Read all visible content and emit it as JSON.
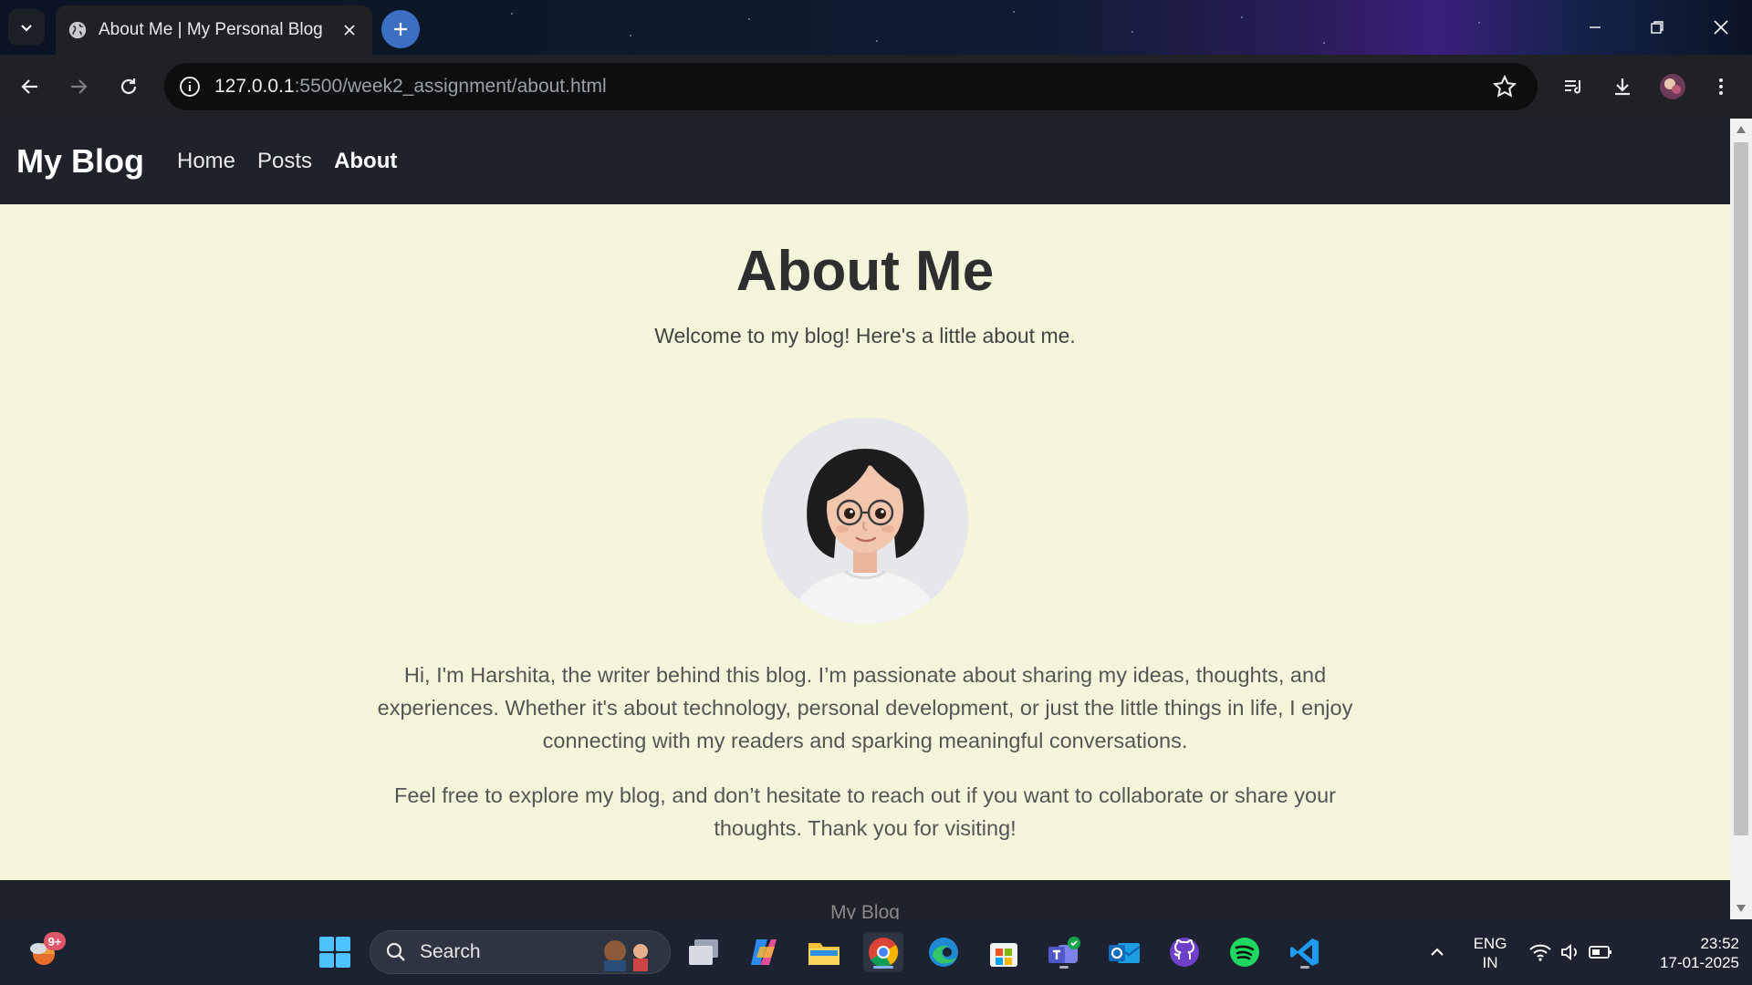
{
  "browser": {
    "tab_title": "About Me | My Personal Blog",
    "url_host": "127.0.0.1",
    "url_path": ":5500/week2_assignment/about.html"
  },
  "site": {
    "brand": "My Blog",
    "nav": [
      {
        "label": "Home",
        "active": false
      },
      {
        "label": "Posts",
        "active": false
      },
      {
        "label": "About",
        "active": true
      }
    ],
    "heading": "About Me",
    "subtitle": "Welcome to my blog! Here's a little about me.",
    "bio_1": "Hi, I'm Harshita, the writer behind this blog. I’m passionate about sharing my ideas, thoughts, and experiences. Whether it's about technology, personal development, or just the little things in life, I enjoy connecting with my readers and sparking meaningful conversations.",
    "bio_2": "Feel free to explore my blog, and don’t hesitate to reach out if you want to collaborate or share your thoughts. Thank you for visiting!",
    "footer": "My Blog"
  },
  "taskbar": {
    "weather_badge": "9+",
    "search_label": "Search",
    "lang_line1": "ENG",
    "lang_line2": "IN",
    "time": "23:52",
    "date": "17-01-2025"
  },
  "colors": {
    "page_bg": "#f5f5dc",
    "nav_bg": "#1f2329",
    "accent_new_tab": "#3a6fc4"
  }
}
